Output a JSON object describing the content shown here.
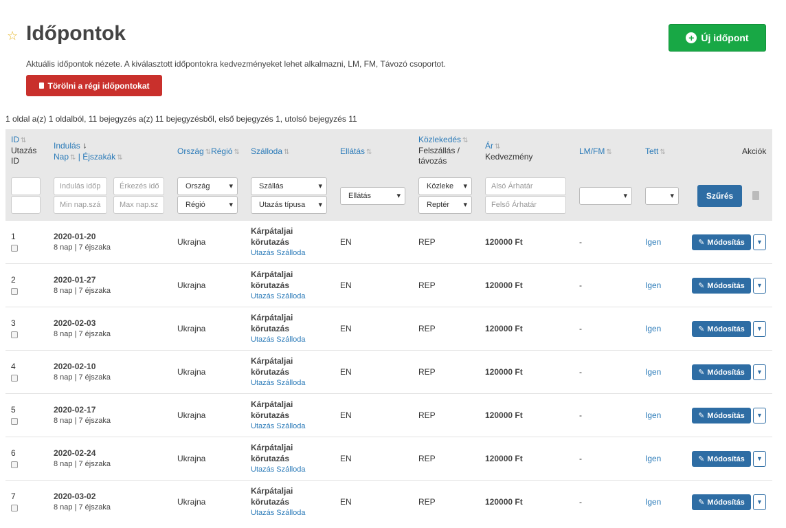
{
  "page": {
    "title": "Időpontok",
    "new_button": "Új időpont",
    "description": "Aktuális időpontok nézete. A kiválasztott időpontokra kedvezményeket lehet alkalmazni, LM, FM, Távozó csoportot.",
    "delete_old_button": "Törölni a régi időpontokat",
    "paging_info": "1 oldal a(z) 1 oldalból, 11 bejegyzés a(z) 11 bejegyzésből, első bejegyzés 1, utolsó bejegyzés 11"
  },
  "columns": {
    "id": "ID",
    "id_sub1": "Utazás",
    "id_sub2": "ID",
    "departure": "Indulás",
    "days": "Nap",
    "separator": "|",
    "nights": "Éjszakák",
    "country": "Ország",
    "region": "Régió",
    "hotel": "Szálloda",
    "board": "Ellátás",
    "transport": "Közlekedés",
    "transport_sub1": "Felszállás /",
    "transport_sub2": "távozás",
    "price": "Ár",
    "discount": "Kedvezmény",
    "lmfm": "LM/FM",
    "tett": "Tett",
    "actions": "Akciók"
  },
  "filters": {
    "departure_from_placeholder": "Indulás időp",
    "arrival_placeholder": "Érkezés idő",
    "min_days_placeholder": "Min nap.szá",
    "max_days_placeholder": "Max nap.sz",
    "country": "Ország",
    "region": "Régió",
    "hotel": "Szállás",
    "trip_type": "Utazás típusa",
    "board": "Ellátás",
    "transport": "Közleke",
    "pickup": "Reptér",
    "price_min_placeholder": "Alsó Árhatár",
    "price_max_placeholder": "Felső Árhatár",
    "lmfm": "",
    "tett": "",
    "filter_button": "Szűrés"
  },
  "rows": [
    {
      "id": "1",
      "date": "2020-01-20",
      "duration": "8 nap | 7 éjszaka",
      "country": "Ukrajna",
      "hotel_l1": "Kárpátaljai",
      "hotel_l2": "körutazás",
      "hotel_type": "Utazás Szálloda",
      "board": "EN",
      "transport": "REP",
      "price": "120000 Ft",
      "lmfm": "-",
      "tett": "Igen",
      "action": "Módosítás"
    },
    {
      "id": "2",
      "date": "2020-01-27",
      "duration": "8 nap | 7 éjszaka",
      "country": "Ukrajna",
      "hotel_l1": "Kárpátaljai",
      "hotel_l2": "körutazás",
      "hotel_type": "Utazás Szálloda",
      "board": "EN",
      "transport": "REP",
      "price": "120000 Ft",
      "lmfm": "-",
      "tett": "Igen",
      "action": "Módosítás"
    },
    {
      "id": "3",
      "date": "2020-02-03",
      "duration": "8 nap | 7 éjszaka",
      "country": "Ukrajna",
      "hotel_l1": "Kárpátaljai",
      "hotel_l2": "körutazás",
      "hotel_type": "Utazás Szálloda",
      "board": "EN",
      "transport": "REP",
      "price": "120000 Ft",
      "lmfm": "-",
      "tett": "Igen",
      "action": "Módosítás"
    },
    {
      "id": "4",
      "date": "2020-02-10",
      "duration": "8 nap | 7 éjszaka",
      "country": "Ukrajna",
      "hotel_l1": "Kárpátaljai",
      "hotel_l2": "körutazás",
      "hotel_type": "Utazás Szálloda",
      "board": "EN",
      "transport": "REP",
      "price": "120000 Ft",
      "lmfm": "-",
      "tett": "Igen",
      "action": "Módosítás"
    },
    {
      "id": "5",
      "date": "2020-02-17",
      "duration": "8 nap | 7 éjszaka",
      "country": "Ukrajna",
      "hotel_l1": "Kárpátaljai",
      "hotel_l2": "körutazás",
      "hotel_type": "Utazás Szálloda",
      "board": "EN",
      "transport": "REP",
      "price": "120000 Ft",
      "lmfm": "-",
      "tett": "Igen",
      "action": "Módosítás"
    },
    {
      "id": "6",
      "date": "2020-02-24",
      "duration": "8 nap | 7 éjszaka",
      "country": "Ukrajna",
      "hotel_l1": "Kárpátaljai",
      "hotel_l2": "körutazás",
      "hotel_type": "Utazás Szálloda",
      "board": "EN",
      "transport": "REP",
      "price": "120000 Ft",
      "lmfm": "-",
      "tett": "Igen",
      "action": "Módosítás"
    },
    {
      "id": "7",
      "date": "2020-03-02",
      "duration": "8 nap | 7 éjszaka",
      "country": "Ukrajna",
      "hotel_l1": "Kárpátaljai",
      "hotel_l2": "körutazás",
      "hotel_type": "Utazás Szálloda",
      "board": "EN",
      "transport": "REP",
      "price": "120000 Ft",
      "lmfm": "-",
      "tett": "Igen",
      "action": "Módosítás"
    }
  ]
}
